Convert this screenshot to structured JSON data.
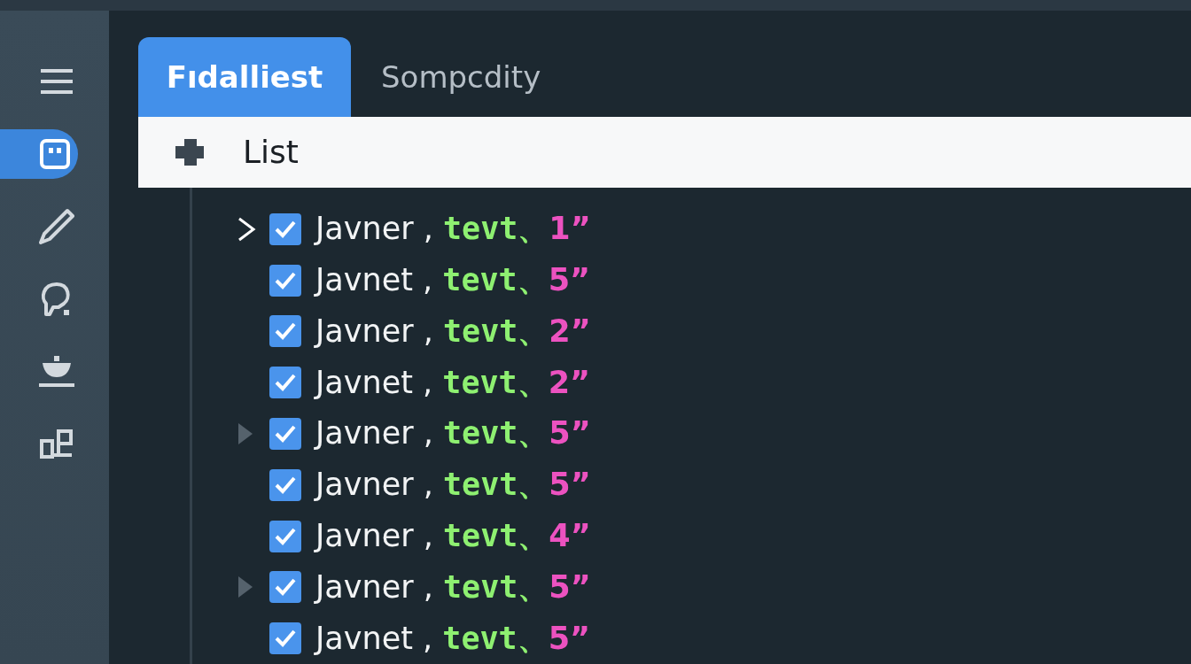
{
  "sidebar": {
    "items": [
      {
        "selected": false
      },
      {
        "selected": true
      },
      {
        "selected": false
      },
      {
        "selected": false
      },
      {
        "selected": false
      },
      {
        "selected": false
      }
    ]
  },
  "tabs": [
    {
      "label": "Fıdalliest",
      "selected": true
    },
    {
      "label": "Sompcdity",
      "selected": false
    }
  ],
  "toolbar": {
    "title": "List"
  },
  "rows": [
    {
      "kind": "chevron",
      "checked": true,
      "name": "Javner ,",
      "tag": "tevt、",
      "count": "1”"
    },
    {
      "kind": "plain",
      "checked": true,
      "name": "Javnet ,",
      "tag": "tevt、",
      "count": "5”"
    },
    {
      "kind": "plain",
      "checked": true,
      "name": "Javner ,",
      "tag": "tevt、",
      "count": "2”"
    },
    {
      "kind": "plain",
      "checked": true,
      "name": "Javnet ,",
      "tag": "tevt、",
      "count": "2”"
    },
    {
      "kind": "triangle",
      "checked": true,
      "name": "Javner ,",
      "tag": "tevt、",
      "count": "5”"
    },
    {
      "kind": "plain",
      "checked": true,
      "name": "Javner ,",
      "tag": "tevt、",
      "count": "5”"
    },
    {
      "kind": "plain",
      "checked": true,
      "name": "Javner ,",
      "tag": "tevt、",
      "count": "4”"
    },
    {
      "kind": "triangle",
      "checked": true,
      "name": "Javner ,",
      "tag": "tevt、",
      "count": "5”"
    },
    {
      "kind": "plain",
      "checked": true,
      "name": "Javnet ,",
      "tag": "tevt、",
      "count": "5”"
    }
  ]
}
